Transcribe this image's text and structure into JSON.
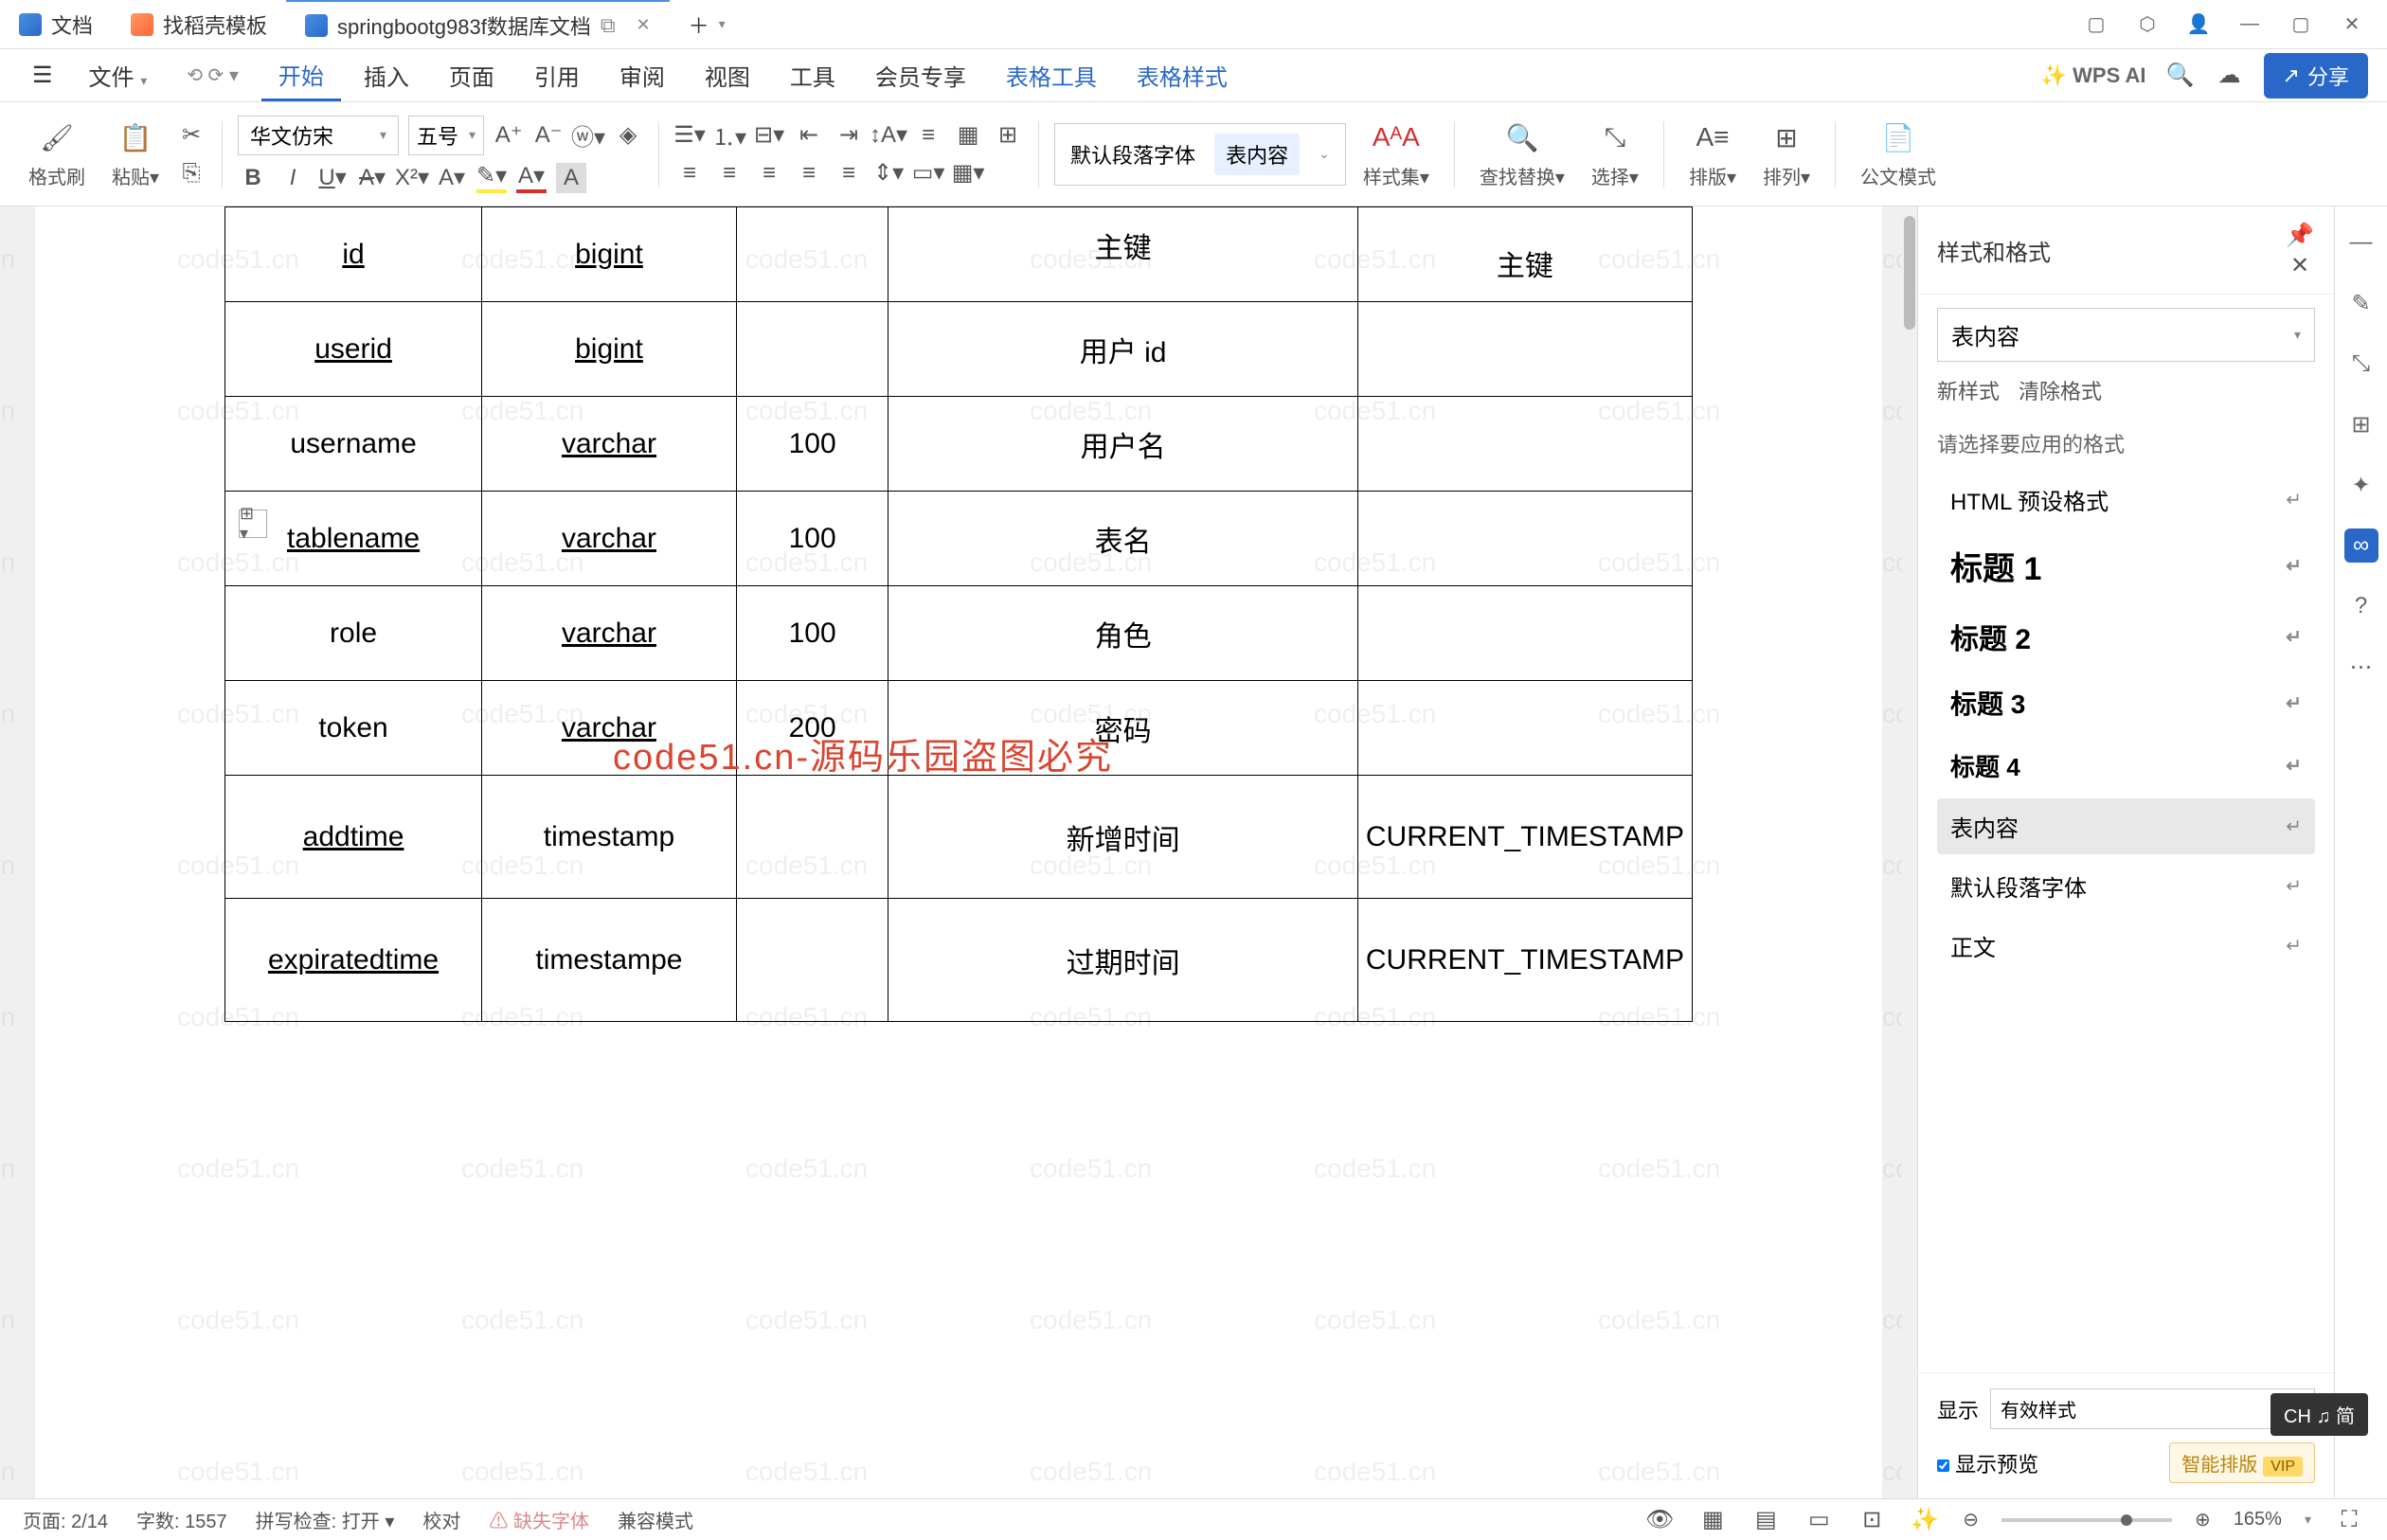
{
  "titlebar": {
    "tabs": [
      {
        "icon": "doc",
        "label": "文档"
      },
      {
        "icon": "orange",
        "label": "找稻壳模板"
      },
      {
        "icon": "word",
        "label": "springbootg983f数据库文档",
        "active": true
      }
    ],
    "add_tab": "＋"
  },
  "menubar": {
    "file": "文件",
    "items": [
      "开始",
      "插入",
      "页面",
      "引用",
      "审阅",
      "视图",
      "工具",
      "会员专享",
      "表格工具",
      "表格样式"
    ],
    "active_index": 0,
    "wps_ai": "WPS AI",
    "share": "分享"
  },
  "ribbon": {
    "format_painter": "格式刷",
    "paste": "粘贴",
    "font_name": "华文仿宋",
    "font_size": "五号",
    "para_default": "默认段落字体",
    "para_selected": "表内容",
    "styleset": "样式集",
    "find_replace": "查找替换",
    "select": "选择",
    "arrange": "排版",
    "sort": "排列",
    "official_mode": "公文模式"
  },
  "doc": {
    "table_rows": [
      {
        "c0": "id",
        "c1": "bigint",
        "c2": "",
        "c3": "主键",
        "c4": "主键",
        "c0u": true,
        "c1u": true
      },
      {
        "c0": "userid",
        "c1": "bigint",
        "c2": "",
        "c3": "用户 id",
        "c4": "",
        "c0u": true,
        "c1u": true
      },
      {
        "c0": "username",
        "c1": "varchar",
        "c2": "100",
        "c3": "用户名",
        "c4": "",
        "c1u": true
      },
      {
        "c0": "tablename",
        "c1": "varchar",
        "c2": "100",
        "c3": "表名",
        "c4": "",
        "c0u": true,
        "c1u": true
      },
      {
        "c0": "role",
        "c1": "varchar",
        "c2": "100",
        "c3": "角色",
        "c4": "",
        "c1u": true
      },
      {
        "c0": "token",
        "c1": "varchar",
        "c2": "200",
        "c3": "密码",
        "c4": "",
        "c1u": true
      },
      {
        "c0": "addtime",
        "c1": "timestamp",
        "c2": "",
        "c3": "新增时间",
        "c4": "CURRENT_TIMESTAMP",
        "c0u": true
      },
      {
        "c0": "expiratedtime",
        "c1": "timestampe",
        "c2": "",
        "c3": "过期时间",
        "c4": "CURRENT_TIMESTAMP",
        "c0u": true
      }
    ],
    "watermark_text": "code51.cn",
    "watermark_red": "code51.cn-源码乐园盗图必究"
  },
  "right_panel": {
    "title": "样式和格式",
    "current_style": "表内容",
    "new_style": "新样式",
    "clear_fmt": "清除格式",
    "hint": "请选择要应用的格式",
    "styles": [
      {
        "label": "HTML 预设格式",
        "cls": ""
      },
      {
        "label": "标题 1",
        "cls": "h1"
      },
      {
        "label": "标题 2",
        "cls": "h2"
      },
      {
        "label": "标题 3",
        "cls": "h3"
      },
      {
        "label": "标题 4",
        "cls": "h4"
      },
      {
        "label": "表内容",
        "cls": "",
        "selected": true
      },
      {
        "label": "默认段落字体",
        "cls": ""
      },
      {
        "label": "正文",
        "cls": ""
      }
    ],
    "show_label": "显示",
    "show_value": "有效样式",
    "preview_label": "显示预览",
    "smart_layout": "智能排版",
    "vip": "VIP"
  },
  "statusbar": {
    "page": "页面: 2/14",
    "words": "字数: 1557",
    "spell": "拼写检查: 打开",
    "proof": "校对",
    "missing_font": "缺失字体",
    "compat": "兼容模式",
    "zoom": "165%"
  },
  "ime": {
    "label": "CH ♫ 简"
  }
}
